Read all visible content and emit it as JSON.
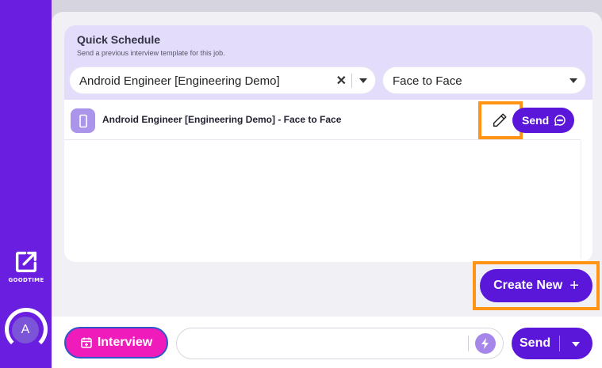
{
  "sidebar": {
    "launcher_label": "GOODTIME",
    "avatar_initial": "A"
  },
  "quick_schedule": {
    "title": "Quick Schedule",
    "subtitle": "Send a previous interview template for this job.",
    "job_select_value": "Android Engineer [Engineering Demo]",
    "type_select_value": "Face to Face",
    "clear_glyph": "✕"
  },
  "templates": [
    {
      "title": "Android Engineer [Engineering Demo] - Face to Face",
      "send_label": "Send"
    }
  ],
  "actions": {
    "create_new_label": "Create New",
    "create_new_icon": "+"
  },
  "composer": {
    "interview_label": "Interview",
    "message_value": "",
    "send_label": "Send"
  },
  "colors": {
    "brand_purple": "#5a17d9",
    "sidebar_purple": "#6a1ee0",
    "interview_pink": "#ef1bba",
    "highlight_orange": "#ff9416",
    "header_lavender": "#e4dcfb"
  }
}
